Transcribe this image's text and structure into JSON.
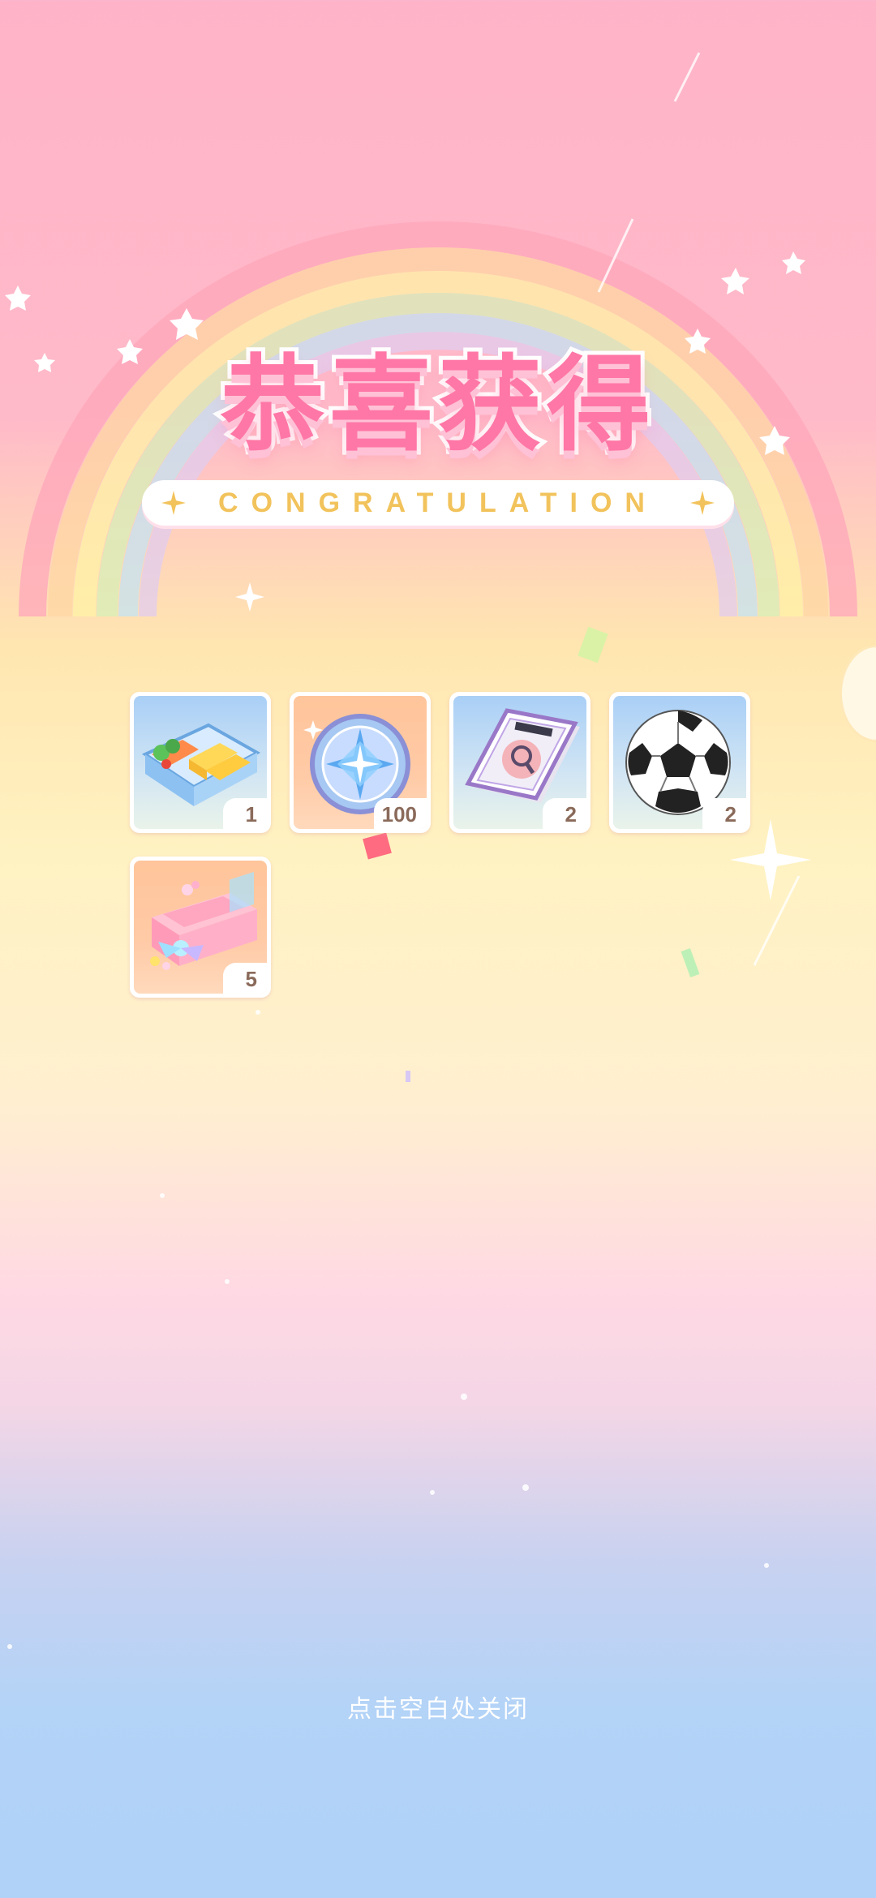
{
  "title": "恭喜获得",
  "subtitle": "CONGRATULATION",
  "rewards": [
    {
      "name": "bento-box-icon",
      "quantity": "1",
      "background": "blue"
    },
    {
      "name": "star-coin-icon",
      "quantity": "100",
      "background": "orange"
    },
    {
      "name": "magazine-book-icon",
      "quantity": "2",
      "background": "blue"
    },
    {
      "name": "soccer-ball-icon",
      "quantity": "2",
      "background": "blue"
    },
    {
      "name": "gift-box-icon",
      "quantity": "5",
      "background": "orange"
    }
  ],
  "close_hint": "点击空白处关闭",
  "colors": {
    "title_pink": "#ff77a6",
    "subtitle_gold": "#f2c35c",
    "bg_top": "#ffb3c8",
    "bg_bottom": "#b0d2f8"
  }
}
